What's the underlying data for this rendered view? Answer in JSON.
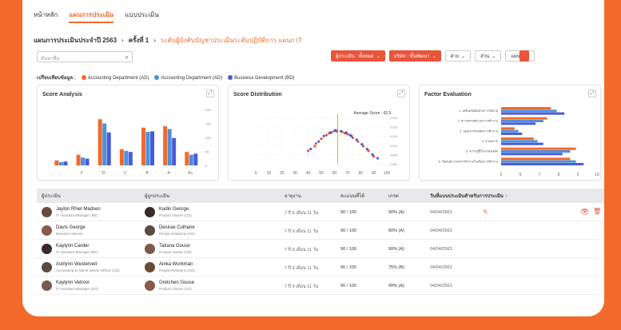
{
  "nav": {
    "items": [
      "หน้าหลัก",
      "แผนการประเมิน",
      "แบบประเมิน"
    ],
    "active": 1
  },
  "breadcrumb": {
    "part1": "แผนการประเมินประจำปี 2563",
    "part2": "ครั้งที่ 1",
    "part3": "ระดับผู้บังคับบัญชาประเมินระดับปฏิบัติการ แผนก IT"
  },
  "search": {
    "placeholder": "ค้นหาชื่อ"
  },
  "filters": [
    {
      "label": "ผู้ประเมิน : ทั้งหมด",
      "style": "orange"
    },
    {
      "label": "บริษัท : ขั้นพัฒนา",
      "style": "orange"
    },
    {
      "label": "ฝ่าย",
      "style": "white"
    },
    {
      "label": "ส่วน",
      "style": "white"
    },
    {
      "label": "แผนก",
      "style": "white"
    }
  ],
  "legend": {
    "label": "เปรียบเทียบข้อมูล :",
    "items": [
      {
        "name": "Accounting Department (AD)",
        "color": "#f26a2a"
      },
      {
        "name": "Accounting Department (AD)",
        "color": "#4a90e2"
      },
      {
        "name": "Business Development (BD)",
        "color": "#4b5bd6"
      }
    ]
  },
  "panels": {
    "score": "Score Analysis",
    "dist": "Score Distribution",
    "factor": "Factor Evaluation"
  },
  "chart_data": [
    {
      "type": "bar",
      "title": "Score Analysis",
      "categories": [
        "-",
        "F",
        "D",
        "C",
        "B",
        "A",
        "A+"
      ],
      "series": [
        {
          "values": [
            18,
            38,
            165,
            58,
            135,
            140,
            48
          ]
        },
        {
          "values": [
            12,
            28,
            150,
            52,
            120,
            130,
            38
          ]
        },
        {
          "values": [
            14,
            24,
            118,
            48,
            122,
            98,
            42
          ]
        }
      ],
      "ylim": [
        0,
        200
      ],
      "yticks": [
        "200",
        "150",
        "100",
        "50",
        "0"
      ]
    },
    {
      "type": "scatter",
      "title": "Score Distribution",
      "annotation": "Average Score : 62.5",
      "average": 62.5,
      "xticks": [
        0,
        10,
        20,
        30,
        40,
        50,
        60,
        70,
        80,
        90,
        100
      ],
      "xlim": [
        0,
        100
      ],
      "yticks": [
        "0.025",
        "0.020",
        "0.015",
        "0.010",
        "0.005",
        "0.000"
      ],
      "ylim": [
        0,
        0.025
      ],
      "series": [
        {
          "color": "#e9543a",
          "points": [
            [
              40,
              0.007
            ],
            [
              46,
              0.011
            ],
            [
              50,
              0.0135
            ],
            [
              54,
              0.0155
            ],
            [
              58,
              0.017
            ],
            [
              62,
              0.0175
            ],
            [
              66,
              0.0172
            ],
            [
              70,
              0.016
            ],
            [
              74,
              0.014
            ],
            [
              78,
              0.012
            ],
            [
              82,
              0.0095
            ],
            [
              86,
              0.007
            ],
            [
              90,
              0.004
            ],
            [
              45,
              0.0095
            ],
            [
              56,
              0.0165
            ],
            [
              68,
              0.0165
            ]
          ]
        },
        {
          "color": "#4b5bd6",
          "points": [
            [
              42,
              0.008
            ],
            [
              48,
              0.012
            ],
            [
              52,
              0.015
            ],
            [
              57,
              0.0168
            ],
            [
              61,
              0.018
            ],
            [
              65,
              0.0176
            ],
            [
              69,
              0.0168
            ],
            [
              73,
              0.015
            ],
            [
              77,
              0.013
            ],
            [
              81,
              0.0105
            ],
            [
              85,
              0.008
            ],
            [
              89,
              0.005
            ],
            [
              93,
              0.003
            ],
            [
              60,
              0.0178
            ],
            [
              72,
              0.0155
            ]
          ]
        }
      ]
    },
    {
      "type": "bar",
      "orientation": "horizontal",
      "title": "Factor Evaluation",
      "categories": [
        "1. เตรียมข้อมือทางการวิทยาย",
        "2. ความตรงต่อเวลาการทำงาน",
        "3. บอลเกาทรงอัตรการทำงาน",
        "4. อวดสจาก",
        "5. ความรู้นี้ในงานเพจจัด",
        "6. ข้อมันอ้าวเลขการทำงานในเรื่องการทำงาน"
      ],
      "series": [
        {
          "values": [
            7.6,
            7.4,
            5.7,
            6.7,
            8.9,
            8.6
          ]
        },
        {
          "values": [
            7.9,
            7.2,
            5.9,
            6.9,
            8.6,
            8.9
          ]
        },
        {
          "values": [
            8.3,
            6.8,
            6.1,
            7.2,
            8.2,
            9.3
          ]
        }
      ],
      "xlim": [
        5,
        10
      ],
      "xticks": [
        5,
        6,
        7,
        8,
        9,
        10
      ]
    }
  ],
  "table": {
    "headers": {
      "evaluator": "ผู้ประเมิน",
      "evaluatee": "ผู้ถูกประเมิน",
      "tenure": "อายุงาน",
      "score": "คะแนนที่ได้",
      "grade": "เกรด",
      "date": "วันที่แบบประเมินสำหรับการประเมิน ↑"
    },
    "rows": [
      {
        "e_name": "Jaylon Rhiel Madsen",
        "e_role": "IT Assistant Manager (RE)",
        "t_name": "Kadin George",
        "t_role": "Product Owner (CD)",
        "tenure": "7 ปี 9 เดือน 11 วัน",
        "score": "90 / 100",
        "grade": "90% (A)",
        "date": "04/04/2563"
      },
      {
        "e_name": "Davis George",
        "e_role": "Brandon Hanson",
        "t_name": "Desirae Culhane",
        "t_role": "People Relations (CD)",
        "tenure": "7 ปี 9 เดือน 11 วัน",
        "score": "90 / 100",
        "grade": "80% (A)",
        "date": "04/04/2563"
      },
      {
        "e_name": "Kaylynn Carder",
        "e_role": "IT Assistant Manager (RE)",
        "t_name": "Tatiana Gouse",
        "t_role": "Product Owner (CD)",
        "tenure": "7 ปี 9 เดือน 11 วัน",
        "score": "90 / 100",
        "grade": "90% (A)",
        "date": "04/04/2563"
      },
      {
        "e_name": "Ashlynn Westervelt",
        "e_role": "Accounting & Admin Senior Officer (CD)",
        "t_name": "Anika Workman",
        "t_role": "People Relations (CD)",
        "tenure": "7 ปี 9 เดือน 11 วัน",
        "score": "90 / 100",
        "grade": "75% (B)",
        "date": "04/04/2563"
      },
      {
        "e_name": "Kaylynn Vetrovr",
        "e_role": "IT Assistant Manager (CD)",
        "t_name": "Gretchen Gouse",
        "t_role": "Product Owner (CD)",
        "tenure": "7 ปี 9 เดือน 11 วัน",
        "score": "90 / 100",
        "grade": "90% (A)",
        "date": "04/04/2563"
      }
    ]
  },
  "colors": {
    "accent": "#f26a2a",
    "series1": "#f26a2a",
    "series2": "#4a90e2",
    "series3": "#4b5bd6"
  }
}
